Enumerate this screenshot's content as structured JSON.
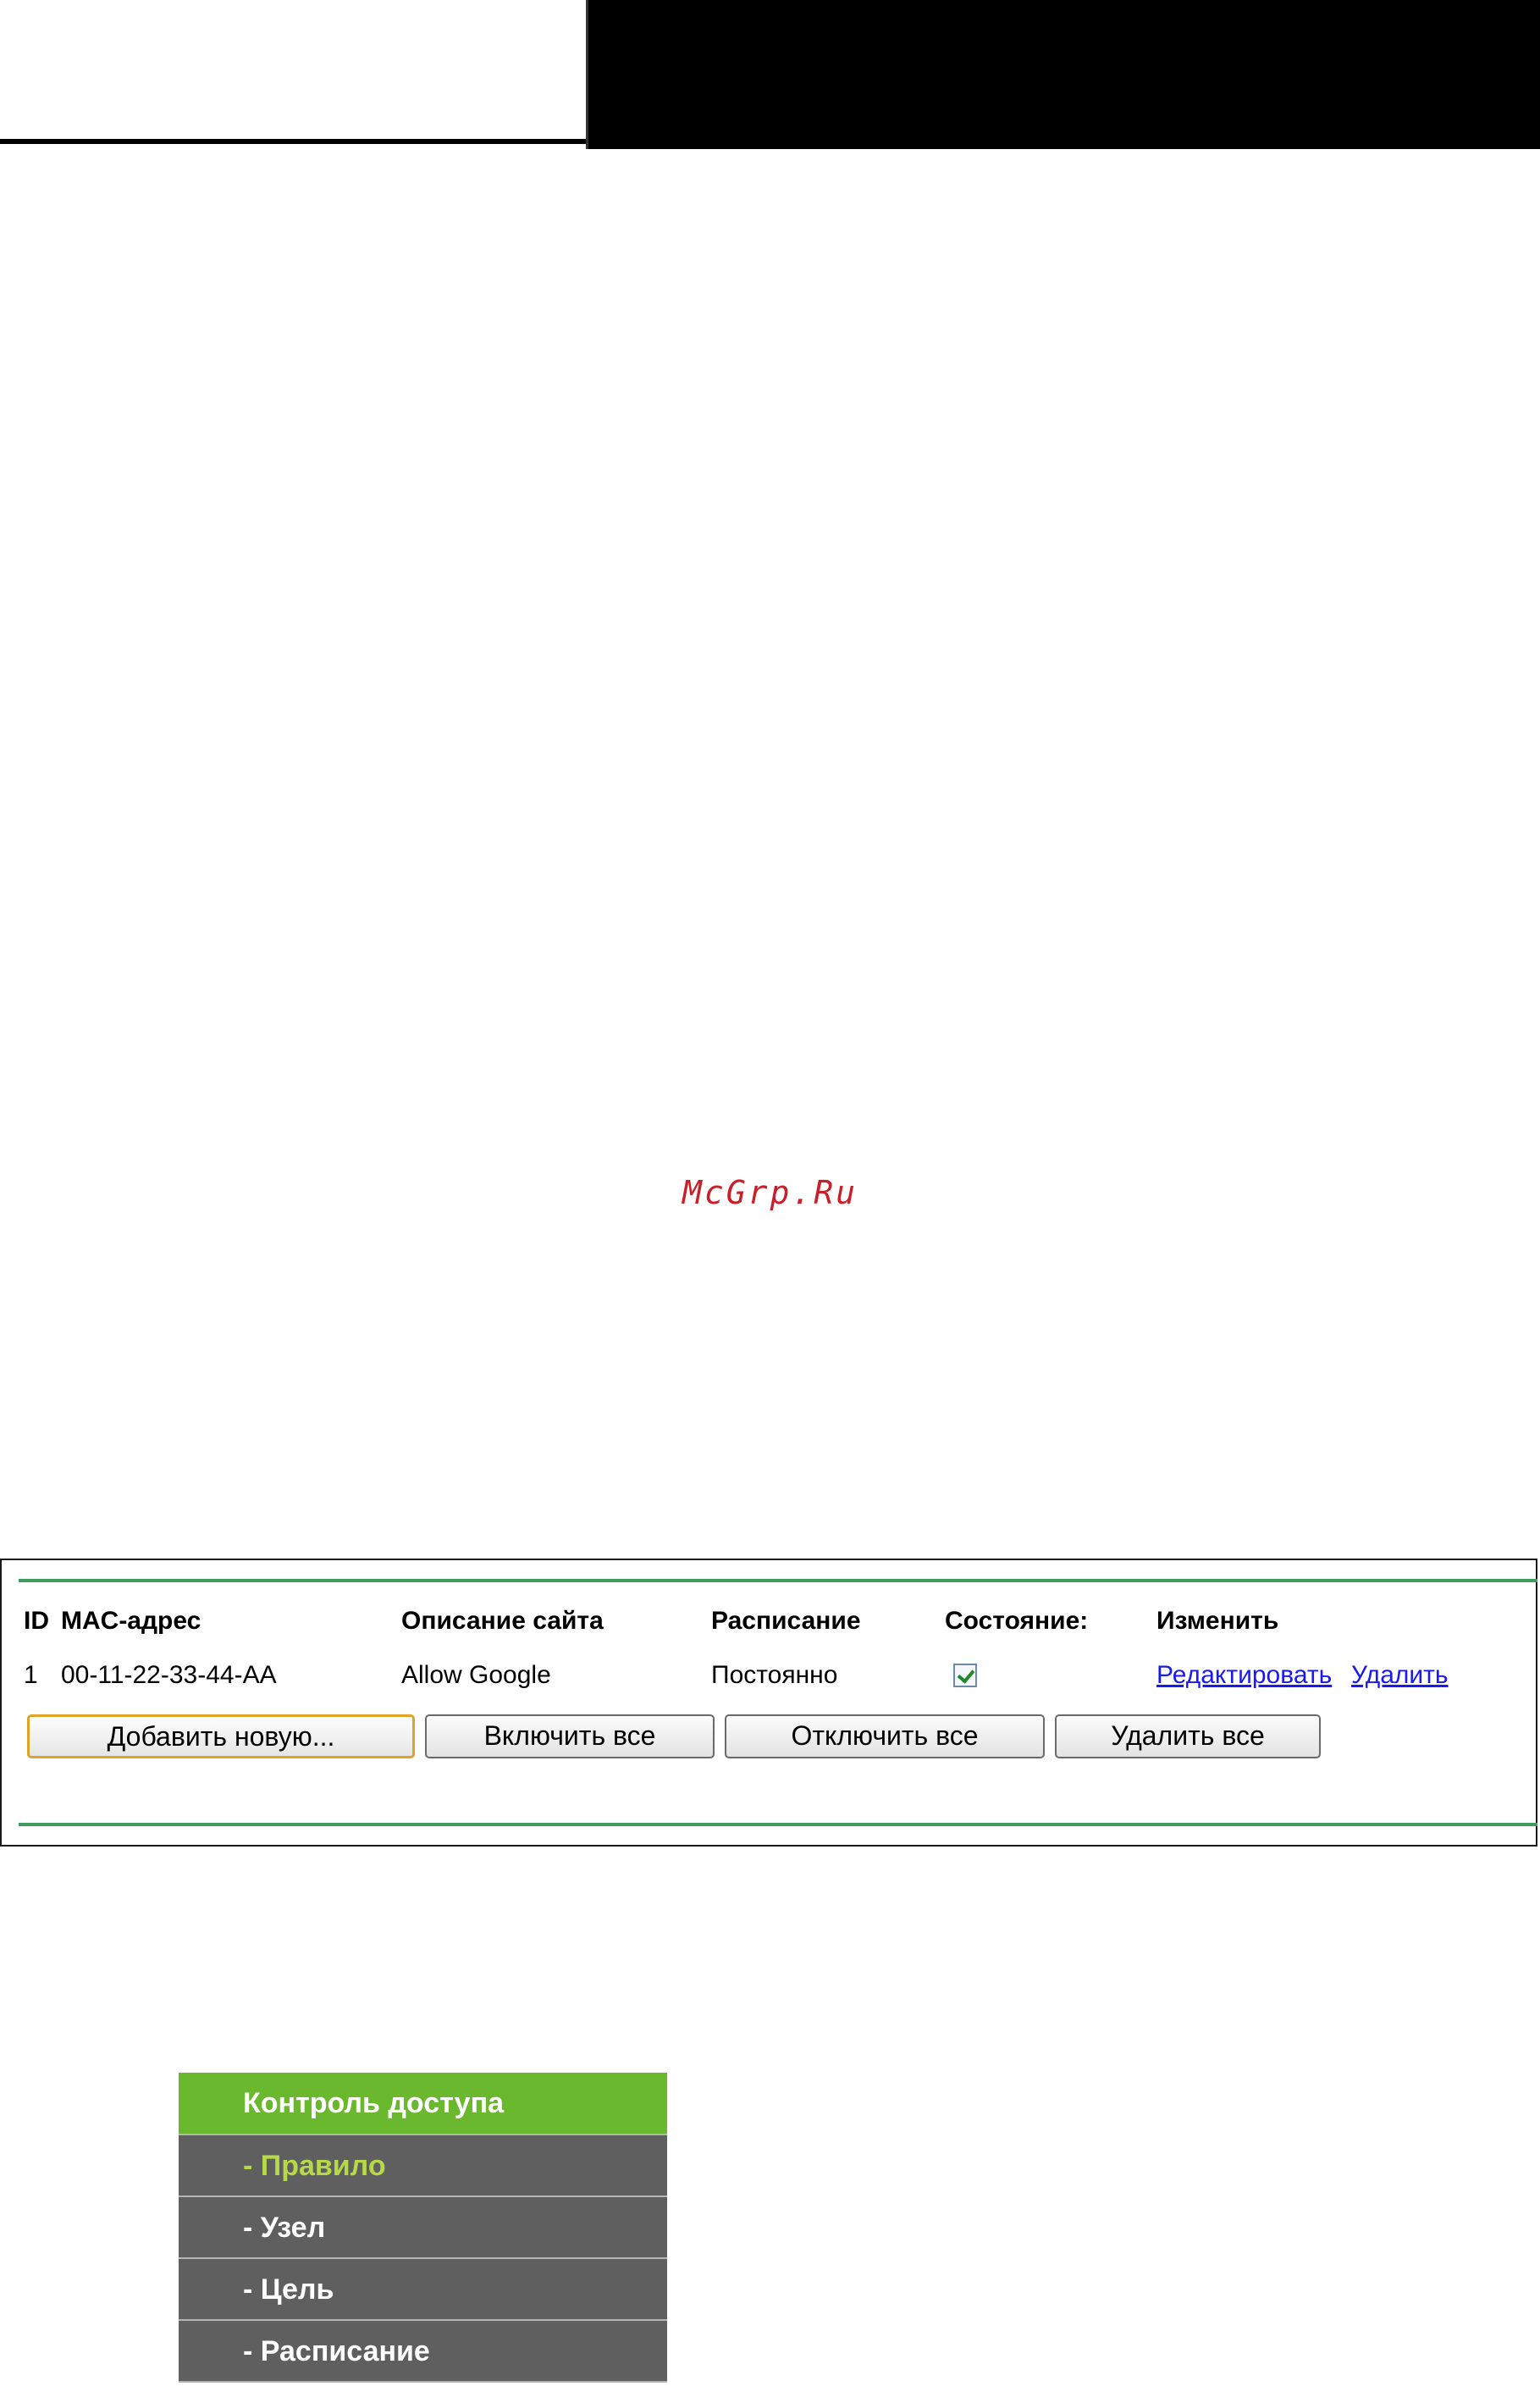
{
  "watermark": "McGrp.Ru",
  "rules_table": {
    "headers": {
      "id": "ID",
      "mac": "MAC-адрес",
      "site_desc": "Описание сайта",
      "schedule": "Расписание",
      "status": "Состояние:",
      "modify": "Изменить"
    },
    "rows": [
      {
        "id": "1",
        "mac": "00-11-22-33-44-AA",
        "site_desc": "Allow Google",
        "schedule": "Постоянно",
        "status_checked": true,
        "edit_label": "Редактировать",
        "delete_label": "Удалить"
      }
    ],
    "buttons": {
      "add_new": "Добавить новую...",
      "enable_all": "Включить все",
      "disable_all": "Отключить все",
      "delete_all": "Удалить все"
    },
    "accent_color": "#3e9b5c"
  },
  "menu": {
    "title": "Контроль доступа",
    "items": [
      {
        "label": "- Правило",
        "active": true
      },
      {
        "label": "- Узел",
        "active": false
      },
      {
        "label": "- Цель",
        "active": false
      },
      {
        "label": "- Расписание",
        "active": false
      }
    ],
    "title_color": "#6ab82d",
    "item_bg_color": "#5f5f5f",
    "active_text_color": "#b6d94a"
  }
}
